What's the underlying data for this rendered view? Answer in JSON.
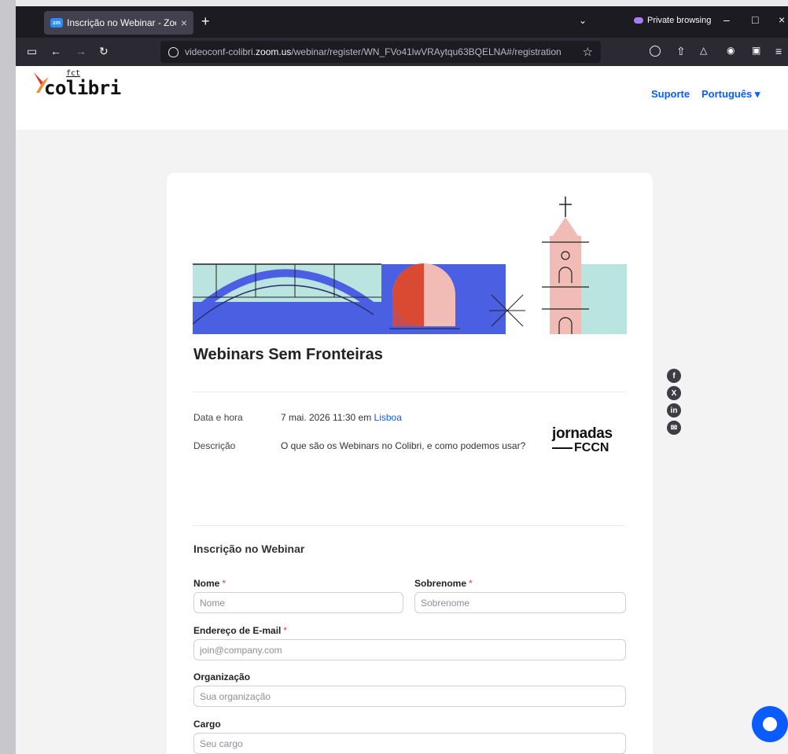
{
  "browser": {
    "tab_title": "Inscrição no Webinar - Zoom",
    "tab_favicon": "zm",
    "tab_close": "×",
    "new_tab": "+",
    "private_label": "Private browsing",
    "url_prefix": "videoconf-colibri.",
    "url_domain": "zoom.us",
    "url_path": "/webinar/register/WN_FVo41lwVRAytqu63BQELNA#/registration"
  },
  "site": {
    "logo_fct": "fct",
    "logo_text": "colibri",
    "support_link": "Suporte",
    "language_selector": "Português ▾"
  },
  "webinar": {
    "title": "Webinars Sem Fronteiras",
    "date_label": "Data e hora",
    "date_value": "7 mai. 2026 11:30 em",
    "timezone_link": "Lisboa",
    "description_label": "Descrição",
    "description_value": "O que são os Webinars no Colibri, e como podemos usar?",
    "sponsor_line1": "jornadas",
    "sponsor_line2": "FCCN"
  },
  "form": {
    "section_title": "Inscrição no Webinar",
    "required_mark": "*",
    "first_name_label": "Nome",
    "first_name_placeholder": "Nome",
    "last_name_label": "Sobrenome",
    "last_name_placeholder": "Sobrenome",
    "email_label": "Endereço de E-mail",
    "email_placeholder": "join@company.com",
    "org_label": "Organização",
    "org_placeholder": "Sua organização",
    "role_label": "Cargo",
    "role_placeholder": "Seu cargo"
  },
  "share": {
    "facebook": "f",
    "x": "X",
    "linkedin": "in",
    "email": "✉"
  },
  "colors": {
    "accent": "#0b5cff",
    "required": "#ee3a3a",
    "banner_blue": "#4b5fe3",
    "banner_mint": "#b9e4df",
    "banner_pink": "#f0bcb5",
    "banner_red": "#d94a32"
  },
  "icons": [
    "zoom-favicon",
    "private-mask-icon",
    "shield-icon",
    "star-icon",
    "facebook-icon",
    "x-icon",
    "linkedin-icon",
    "email-icon",
    "chat-icon"
  ]
}
